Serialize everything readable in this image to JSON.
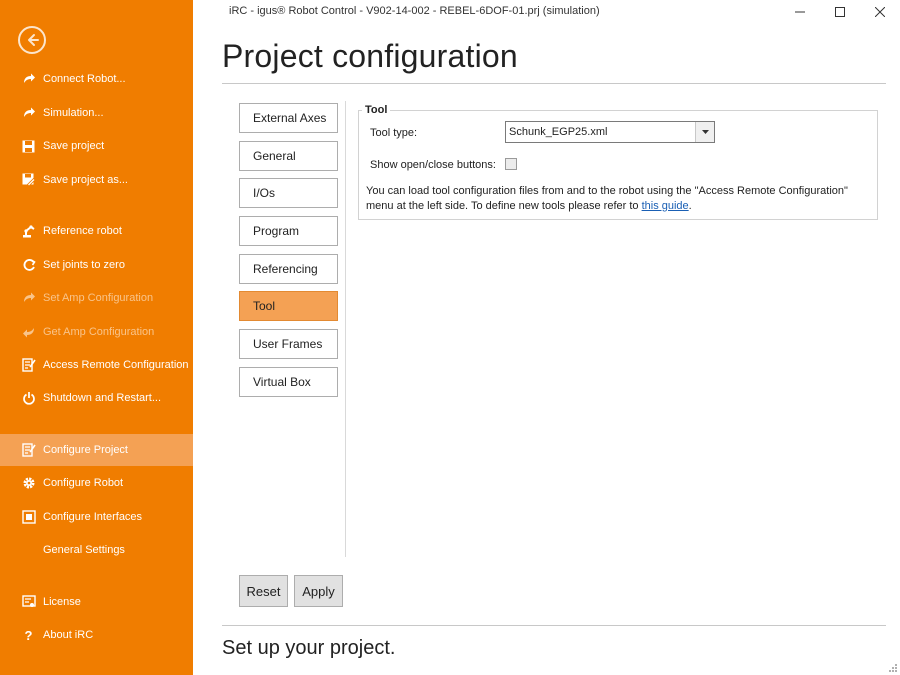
{
  "window": {
    "title": "iRC - igus® Robot Control - V902-14-002 - REBEL-6DOF-01.prj (simulation)"
  },
  "sidebar": {
    "back_icon": "arrow-left-circle-icon",
    "items": [
      {
        "label": "Connect Robot...",
        "icon": "connect-icon",
        "state": "normal"
      },
      {
        "label": "Simulation...",
        "icon": "simulation-icon",
        "state": "normal"
      },
      {
        "label": "Save project",
        "icon": "save-icon",
        "state": "normal"
      },
      {
        "label": "Save project as...",
        "icon": "save-as-icon",
        "state": "normal"
      },
      {
        "label": "Reference robot",
        "icon": "reference-icon",
        "state": "normal"
      },
      {
        "label": "Set joints to zero",
        "icon": "zero-joints-icon",
        "state": "normal"
      },
      {
        "label": "Set Amp Configuration",
        "icon": "set-amp-icon",
        "state": "disabled"
      },
      {
        "label": "Get Amp Configuration",
        "icon": "get-amp-icon",
        "state": "disabled"
      },
      {
        "label": "Access Remote Configuration",
        "icon": "remote-config-icon",
        "state": "normal"
      },
      {
        "label": "Shutdown and Restart...",
        "icon": "power-icon",
        "state": "normal"
      },
      {
        "label": "Configure Project",
        "icon": "configure-project-icon",
        "state": "active"
      },
      {
        "label": "Configure Robot",
        "icon": "gear-icon",
        "state": "normal"
      },
      {
        "label": "Configure Interfaces",
        "icon": "interfaces-icon",
        "state": "normal"
      },
      {
        "label": "General Settings",
        "icon": "",
        "state": "normal"
      },
      {
        "label": "License",
        "icon": "license-icon",
        "state": "normal"
      },
      {
        "label": "About iRC",
        "icon": "question-icon",
        "state": "normal"
      }
    ]
  },
  "header": {
    "title": "Project configuration"
  },
  "tabs": [
    {
      "label": "External Axes",
      "active": false
    },
    {
      "label": "General",
      "active": false
    },
    {
      "label": "I/Os",
      "active": false
    },
    {
      "label": "Program",
      "active": false
    },
    {
      "label": "Referencing",
      "active": false
    },
    {
      "label": "Tool",
      "active": true
    },
    {
      "label": "User Frames",
      "active": false
    },
    {
      "label": "Virtual Box",
      "active": false
    }
  ],
  "tool_panel": {
    "group_title": "Tool",
    "tool_type_label": "Tool type:",
    "tool_type_value": "Schunk_EGP25.xml",
    "show_buttons_label": "Show open/close buttons:",
    "show_buttons_checked": false,
    "info_text": "You can load tool configuration files from and to the robot using the \"Access Remote Configuration\" menu at the left side. To define new tools please refer to ",
    "info_link": "this guide",
    "info_end": "."
  },
  "actions": {
    "reset_label": "Reset",
    "apply_label": "Apply"
  },
  "footer": {
    "status": "Set up your project."
  },
  "colors": {
    "sidebar": "#f07d00",
    "active_item": "#f4a154",
    "link": "#1a5fb4"
  }
}
